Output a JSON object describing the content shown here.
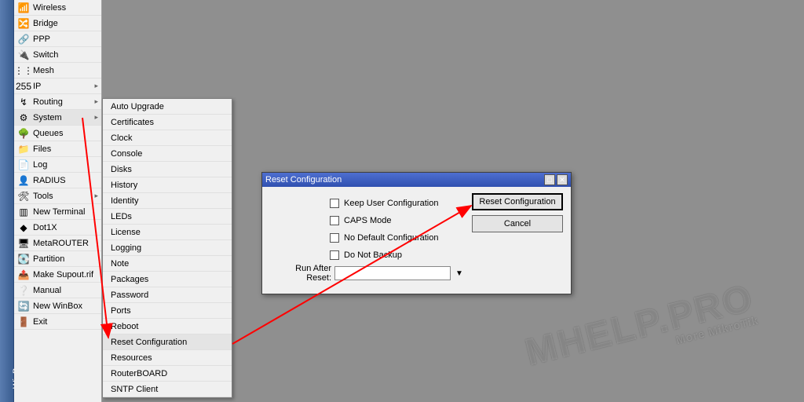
{
  "app": {
    "title_vertical": "WinBox"
  },
  "sidebar": {
    "items": [
      {
        "label": "Wireless",
        "icon": "📶",
        "arrow": false
      },
      {
        "label": "Bridge",
        "icon": "🔀",
        "arrow": false
      },
      {
        "label": "PPP",
        "icon": "🔗",
        "arrow": false
      },
      {
        "label": "Switch",
        "icon": "🔌",
        "arrow": false
      },
      {
        "label": "Mesh",
        "icon": "⋮⋮",
        "arrow": false
      },
      {
        "label": "IP",
        "icon": "255",
        "arrow": true
      },
      {
        "label": "Routing",
        "icon": "↯",
        "arrow": true
      },
      {
        "label": "System",
        "icon": "⚙",
        "arrow": true,
        "hover": true
      },
      {
        "label": "Queues",
        "icon": "🌳",
        "arrow": false
      },
      {
        "label": "Files",
        "icon": "📁",
        "arrow": false
      },
      {
        "label": "Log",
        "icon": "📄",
        "arrow": false
      },
      {
        "label": "RADIUS",
        "icon": "👤",
        "arrow": false
      },
      {
        "label": "Tools",
        "icon": "🛠",
        "arrow": true
      },
      {
        "label": "New Terminal",
        "icon": "▥",
        "arrow": false
      },
      {
        "label": "Dot1X",
        "icon": "◆",
        "arrow": false
      },
      {
        "label": "MetaROUTER",
        "icon": "🖥",
        "arrow": false
      },
      {
        "label": "Partition",
        "icon": "💽",
        "arrow": false
      },
      {
        "label": "Make Supout.rif",
        "icon": "📤",
        "arrow": false
      },
      {
        "label": "Manual",
        "icon": "❔",
        "arrow": false
      },
      {
        "label": "New WinBox",
        "icon": "🔄",
        "arrow": false
      },
      {
        "label": "Exit",
        "icon": "🚪",
        "arrow": false
      }
    ]
  },
  "submenu": {
    "items": [
      "Auto Upgrade",
      "Certificates",
      "Clock",
      "Console",
      "Disks",
      "History",
      "Identity",
      "LEDs",
      "License",
      "Logging",
      "Note",
      "Packages",
      "Password",
      "Ports",
      "Reboot",
      "Reset Configuration",
      "Resources",
      "RouterBOARD",
      "SNTP Client"
    ],
    "hover_index": 15
  },
  "dialog": {
    "title": "Reset Configuration",
    "checks": [
      "Keep User Configuration",
      "CAPS Mode",
      "No Default Configuration",
      "Do Not Backup"
    ],
    "run_label": "Run After Reset:",
    "run_value": "",
    "btn_primary": "Reset Configuration",
    "btn_cancel": "Cancel"
  },
  "watermark": {
    "main": "MHELP.PRO",
    "sub": "More MikroTik"
  }
}
